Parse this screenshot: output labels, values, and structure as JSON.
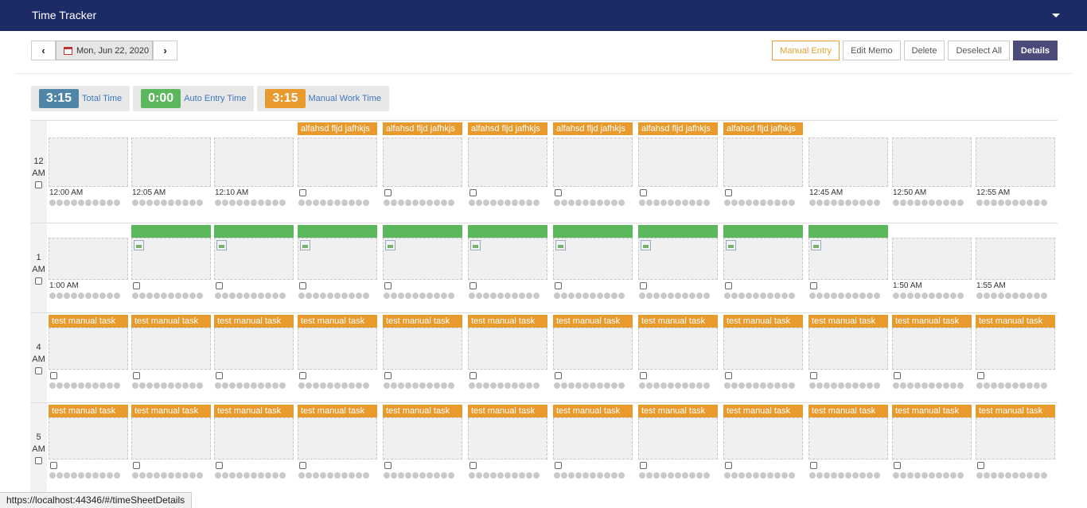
{
  "header": {
    "title": "Time Tracker"
  },
  "datenav": {
    "prev": "‹",
    "next": "›",
    "date": "Mon, Jun 22, 2020"
  },
  "actions": {
    "manual_entry": "Manual Entry",
    "edit_memo": "Edit Memo",
    "delete": "Delete",
    "deselect_all": "Deselect All",
    "details": "Details"
  },
  "summary": [
    {
      "value": "3:15",
      "label": "Total Time",
      "color": "#4f86a8"
    },
    {
      "value": "0:00",
      "label": "Auto Entry Time",
      "color": "#5cb85c"
    },
    {
      "value": "3:15",
      "label": "Manual Work Time",
      "color": "#e89a2c"
    }
  ],
  "hours": [
    {
      "num": "12",
      "ampm": "AM",
      "kind": "tall",
      "slots": [
        {
          "bar": "none",
          "time": "12:00 AM"
        },
        {
          "bar": "none",
          "time": "12:05 AM"
        },
        {
          "bar": "none",
          "time": "12:10 AM"
        },
        {
          "bar": "orange",
          "label": "alfahsd fljd jafhkjs"
        },
        {
          "bar": "orange",
          "label": "alfahsd fljd jafhkjs"
        },
        {
          "bar": "orange",
          "label": "alfahsd fljd jafhkjs"
        },
        {
          "bar": "orange",
          "label": "alfahsd fljd jafhkjs"
        },
        {
          "bar": "orange",
          "label": "alfahsd fljd jafhkjs"
        },
        {
          "bar": "orange",
          "label": "alfahsd fljd jafhkjs"
        },
        {
          "bar": "none",
          "time": "12:45 AM"
        },
        {
          "bar": "none",
          "time": "12:50 AM"
        },
        {
          "bar": "none",
          "time": "12:55 AM"
        }
      ]
    },
    {
      "num": "1",
      "ampm": "AM",
      "kind": "img",
      "slots": [
        {
          "bar": "none",
          "time": "1:00 AM"
        },
        {
          "bar": "green",
          "img": true
        },
        {
          "bar": "green",
          "img": true
        },
        {
          "bar": "green",
          "img": true
        },
        {
          "bar": "green",
          "img": true
        },
        {
          "bar": "green",
          "img": true
        },
        {
          "bar": "green",
          "img": true
        },
        {
          "bar": "green",
          "img": true
        },
        {
          "bar": "green",
          "img": true
        },
        {
          "bar": "green",
          "img": true
        },
        {
          "bar": "none",
          "time": "1:50 AM"
        },
        {
          "bar": "none",
          "time": "1:55 AM"
        }
      ]
    },
    {
      "num": "4",
      "ampm": "AM",
      "kind": "task",
      "slots": [
        {
          "bar": "orange",
          "label": "test manual task"
        },
        {
          "bar": "orange",
          "label": "test manual task"
        },
        {
          "bar": "orange",
          "label": "test manual task"
        },
        {
          "bar": "orange",
          "label": "test manual task"
        },
        {
          "bar": "orange",
          "label": "test manual task"
        },
        {
          "bar": "orange",
          "label": "test manual task"
        },
        {
          "bar": "orange",
          "label": "test manual task"
        },
        {
          "bar": "orange",
          "label": "test manual task"
        },
        {
          "bar": "orange",
          "label": "test manual task"
        },
        {
          "bar": "orange",
          "label": "test manual task"
        },
        {
          "bar": "orange",
          "label": "test manual task"
        },
        {
          "bar": "orange",
          "label": "test manual task"
        }
      ]
    },
    {
      "num": "5",
      "ampm": "AM",
      "kind": "task",
      "slots": [
        {
          "bar": "orange",
          "label": "test manual task"
        },
        {
          "bar": "orange",
          "label": "test manual task"
        },
        {
          "bar": "orange",
          "label": "test manual task"
        },
        {
          "bar": "orange",
          "label": "test manual task"
        },
        {
          "bar": "orange",
          "label": "test manual task"
        },
        {
          "bar": "orange",
          "label": "test manual task"
        },
        {
          "bar": "orange",
          "label": "test manual task"
        },
        {
          "bar": "orange",
          "label": "test manual task"
        },
        {
          "bar": "orange",
          "label": "test manual task"
        },
        {
          "bar": "orange",
          "label": "test manual task"
        },
        {
          "bar": "orange",
          "label": "test manual task"
        },
        {
          "bar": "orange",
          "label": "test manual task"
        }
      ]
    }
  ],
  "status_url": "https://localhost:44346/#/timeSheetDetails"
}
